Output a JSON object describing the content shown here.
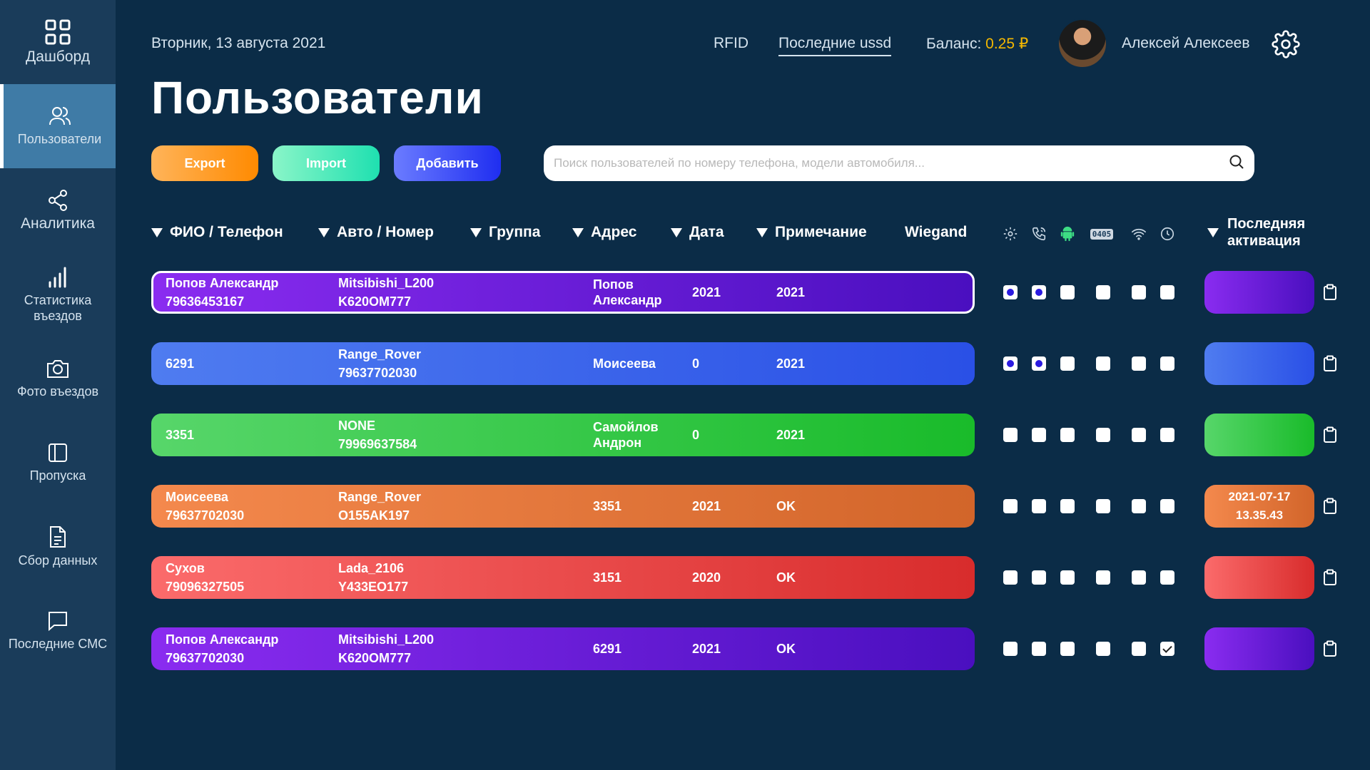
{
  "sidebar": {
    "items": [
      {
        "label": "Дашборд",
        "icon": "grid-icon"
      },
      {
        "label": "Пользователи",
        "icon": "users-icon"
      },
      {
        "label": "Аналитика",
        "icon": "share-icon"
      },
      {
        "label": "Статистика въездов",
        "icon": "bar-chart-icon"
      },
      {
        "label": "Фото въездов",
        "icon": "camera-icon"
      },
      {
        "label": "Пропуска",
        "icon": "panel-icon"
      },
      {
        "label": "Сбор данных",
        "icon": "document-icon"
      },
      {
        "label": "Последние СМС",
        "icon": "message-icon"
      }
    ],
    "active": "Пользователи"
  },
  "header": {
    "date": "Вторник, 13 августа 2021",
    "rfid": "RFID",
    "last_ussd": "Последние ussd",
    "balance_label": "Баланс:",
    "balance_value": "0.25 ₽",
    "user_name": "Алексей Алексеев"
  },
  "page_title": "Пользователи",
  "actions": {
    "export": "Export",
    "import": "Import",
    "add": "Добавить"
  },
  "search": {
    "placeholder": "Поиск пользователей по номеру телефона, модели автомобиля..."
  },
  "columns": {
    "name": "ФИО / Телефон",
    "car": "Авто / Номер",
    "group": "Группа",
    "address": "Адрес",
    "date": "Дата",
    "note": "Примечание",
    "wiegand": "Wiegand",
    "last_activation": "Последняя активация",
    "wiegand_badge": "0405"
  },
  "colors": {
    "background": "#0b2c47",
    "sidebar": "#1a3c5a",
    "sidebar_active": "#3f7ba6",
    "balance_accent": "#f5b800"
  },
  "rows": [
    {
      "name": "Попов Александр",
      "phone": "79636453167",
      "car": "Mitsibishi_L200",
      "plate": "K620OM777",
      "group": "",
      "address": "Попов Александр",
      "date": "2021",
      "note": "2021",
      "wiegand": "",
      "checks": [
        "dot",
        "dot",
        "empty",
        "empty",
        "empty",
        "empty"
      ],
      "activation": "",
      "color": "purple",
      "selected": true
    },
    {
      "name": "6291",
      "phone": "",
      "car": "Range_Rover",
      "plate": "79637702030",
      "group": "",
      "address": "Моисеева",
      "date": "0",
      "note": "2021",
      "wiegand": "",
      "checks": [
        "dot",
        "dot",
        "empty",
        "empty",
        "empty",
        "empty"
      ],
      "activation": "",
      "color": "blue",
      "selected": false
    },
    {
      "name": "3351",
      "phone": "",
      "car": "NONE",
      "plate": "79969637584",
      "group": "",
      "address": "Самойлов Андрон",
      "date": "0",
      "note": "2021",
      "wiegand": "",
      "checks": [
        "empty",
        "empty",
        "empty",
        "empty",
        "empty",
        "empty"
      ],
      "activation": "",
      "color": "green",
      "selected": false
    },
    {
      "name": "Моисеева",
      "phone": "79637702030",
      "car": "Range_Rover",
      "plate": "O155AK197",
      "group": "",
      "address": "3351",
      "date": "2021",
      "note": "OK",
      "wiegand": "",
      "checks": [
        "empty",
        "empty",
        "empty",
        "empty",
        "empty",
        "empty"
      ],
      "activation": "2021-07-17 13.35.43",
      "color": "orange",
      "selected": false
    },
    {
      "name": "Сухов",
      "phone": "79096327505",
      "car": "Lada_2106",
      "plate": "Y433EO177",
      "group": "",
      "address": "3151",
      "date": "2020",
      "note": "OK",
      "wiegand": "",
      "checks": [
        "empty",
        "empty",
        "empty",
        "empty",
        "empty",
        "empty"
      ],
      "activation": "",
      "color": "red",
      "selected": false
    },
    {
      "name": "Попов Александр",
      "phone": "79637702030",
      "car": "Mitsibishi_L200",
      "plate": "K620OM777",
      "group": "",
      "address": "6291",
      "date": "2021",
      "note": "OK",
      "wiegand": "",
      "checks": [
        "empty",
        "empty",
        "empty",
        "empty",
        "empty",
        "check"
      ],
      "activation": "",
      "color": "purple",
      "selected": false
    }
  ]
}
